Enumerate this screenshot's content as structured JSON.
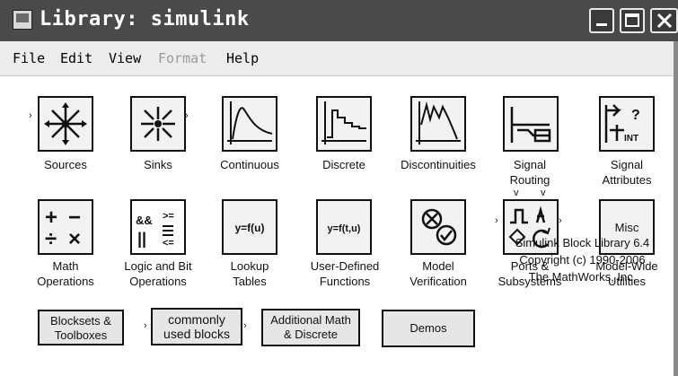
{
  "window": {
    "title": "Library: simulink"
  },
  "menubar": {
    "items": [
      {
        "label": "File",
        "enabled": true
      },
      {
        "label": "Edit",
        "enabled": true
      },
      {
        "label": "View",
        "enabled": true
      },
      {
        "label": "Format",
        "enabled": false
      },
      {
        "label": "Help",
        "enabled": true
      }
    ]
  },
  "blocks": [
    {
      "id": "sources",
      "label_lines": [
        "Sources"
      ]
    },
    {
      "id": "sinks",
      "label_lines": [
        "Sinks"
      ]
    },
    {
      "id": "continuous",
      "label_lines": [
        "Continuous"
      ]
    },
    {
      "id": "discrete",
      "label_lines": [
        "Discrete"
      ]
    },
    {
      "id": "discontinuities",
      "label_lines": [
        "Discontinuities"
      ]
    },
    {
      "id": "signal-routing",
      "label_lines": [
        "Signal",
        "Routing"
      ]
    },
    {
      "id": "signal-attributes",
      "label_lines": [
        "Signal",
        "Attributes"
      ]
    },
    {
      "id": "math-operations",
      "label_lines": [
        "Math",
        "Operations"
      ]
    },
    {
      "id": "logic-and-bit",
      "label_lines": [
        "Logic and Bit",
        "Operations"
      ]
    },
    {
      "id": "lookup-tables",
      "label_lines": [
        "Lookup",
        "Tables"
      ],
      "icon_text": "y=f(u)"
    },
    {
      "id": "user-defined",
      "label_lines": [
        "User-Defined",
        "Functions"
      ],
      "icon_text": "y=f(t,u)"
    },
    {
      "id": "model-verification",
      "label_lines": [
        "Model",
        "Verification"
      ]
    },
    {
      "id": "ports-subsystems",
      "label_lines": [
        "Ports &",
        "Subsystems"
      ]
    },
    {
      "id": "model-wide",
      "label_lines": [
        "Model-Wide",
        "Utilities"
      ],
      "icon_text": "Misc"
    }
  ],
  "buttons": [
    {
      "id": "blocksets",
      "lines": [
        "Blocksets &",
        "Toolboxes"
      ]
    },
    {
      "id": "commonly-used",
      "lines": [
        "commonly",
        "used blocks"
      ]
    },
    {
      "id": "additional-math",
      "lines": [
        "Additional Math",
        "& Discrete"
      ]
    },
    {
      "id": "demos",
      "lines": [
        "Demos"
      ]
    }
  ],
  "info": {
    "lines": [
      "Simulink Block Library 6.4",
      "Copyright (c) 1990-2006",
      "The MathWorks, Inc."
    ]
  },
  "icons": {
    "logic": [
      "&&",
      "||",
      ">=",
      "<="
    ],
    "math": [
      "+",
      "−",
      "÷",
      "×"
    ],
    "attributes": "t INT"
  }
}
